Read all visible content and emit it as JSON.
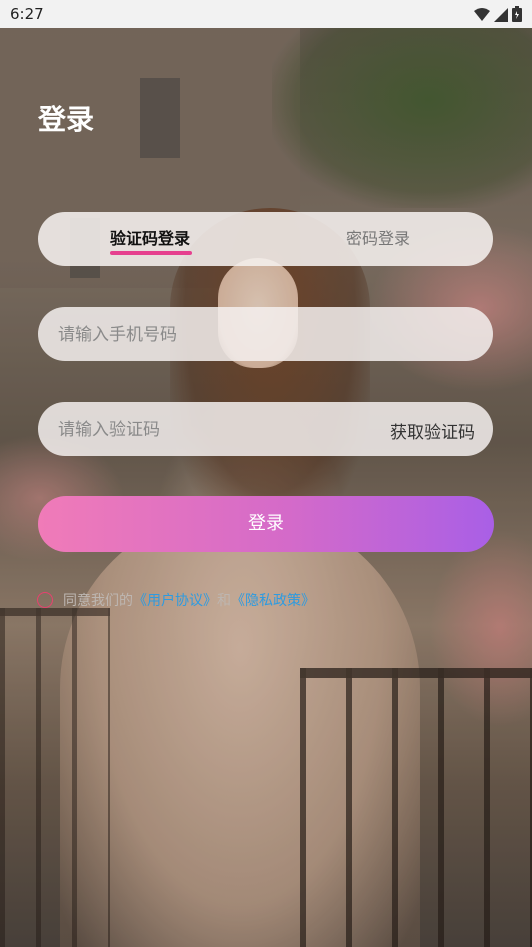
{
  "status_bar": {
    "time": "6:27",
    "icons": [
      "wifi-icon",
      "signal-icon",
      "battery-icon"
    ]
  },
  "page": {
    "title": "登录"
  },
  "tabs": [
    {
      "label": "验证码登录",
      "active": true
    },
    {
      "label": "密码登录",
      "active": false
    }
  ],
  "form": {
    "phone_placeholder": "请输入手机号码",
    "code_placeholder": "请输入验证码",
    "get_code_label": "获取验证码",
    "login_label": "登录"
  },
  "agreement": {
    "prefix": "同意我们的",
    "user_agreement": "《用户协议》",
    "conjunction": "和",
    "privacy_policy": "《隐私政策》"
  },
  "colors": {
    "accent_pink": "#e6408f",
    "button_start": "#f07bb8",
    "button_end": "#a95fe6",
    "link": "#2e9be0",
    "radio_border": "#e8416f"
  }
}
